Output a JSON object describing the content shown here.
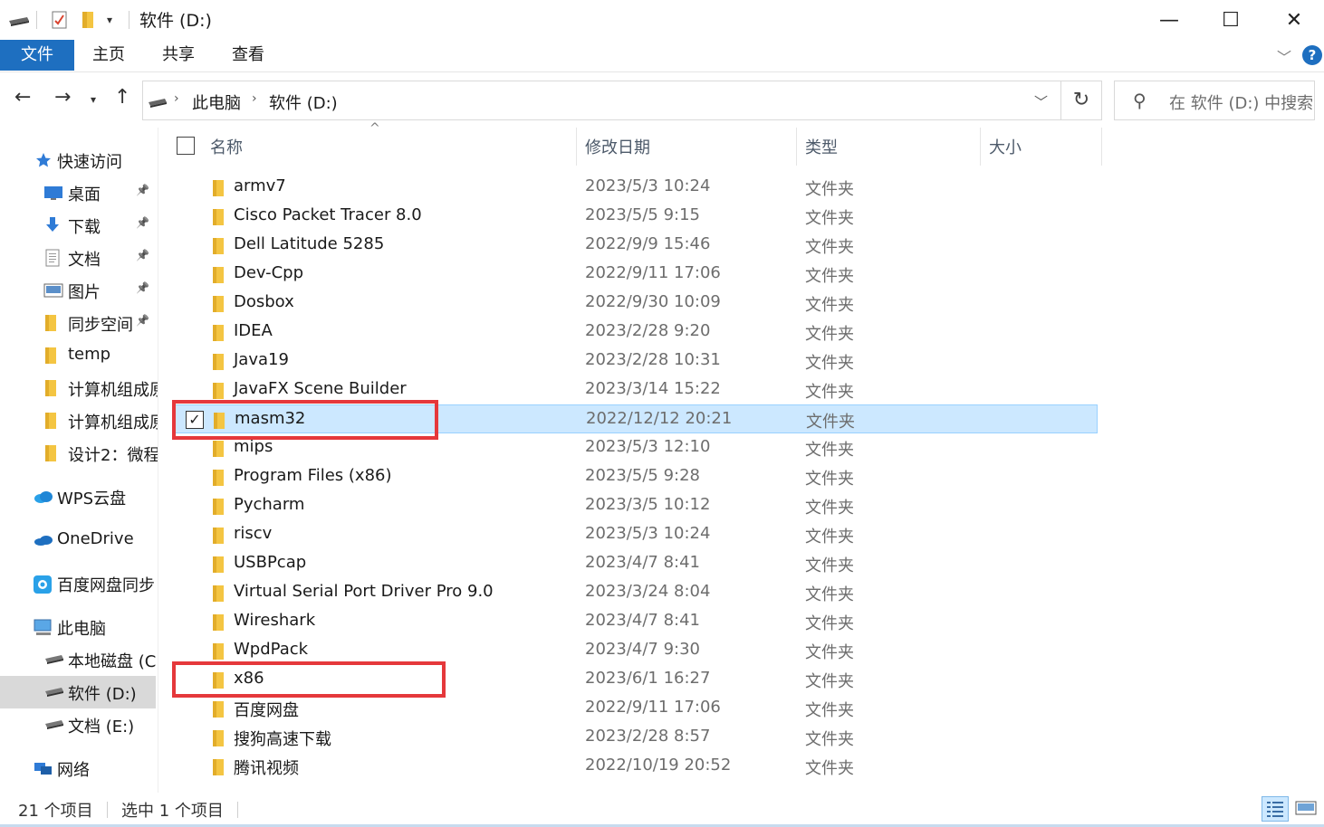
{
  "window": {
    "title": "软件 (D:)",
    "minimize": "—",
    "maximize": "☐",
    "close": "✕"
  },
  "ribbon": {
    "tabs": [
      "文件",
      "主页",
      "共享",
      "查看"
    ],
    "help": "?"
  },
  "nav": {
    "breadcrumb": [
      "此电脑",
      "软件 (D:)"
    ],
    "search_placeholder": "在 软件 (D:) 中搜索"
  },
  "sidebar": {
    "items": [
      {
        "label": "快速访问",
        "icon": "star-icon",
        "pinned": false
      },
      {
        "label": "桌面",
        "icon": "desktop-icon",
        "pinned": true
      },
      {
        "label": "下载",
        "icon": "download-icon",
        "pinned": true
      },
      {
        "label": "文档",
        "icon": "document-icon",
        "pinned": true
      },
      {
        "label": "图片",
        "icon": "pictures-icon",
        "pinned": true
      },
      {
        "label": "同步空间",
        "icon": "folder-icon",
        "pinned": true
      },
      {
        "label": "temp",
        "icon": "folder-icon",
        "pinned": false
      },
      {
        "label": "计算机组成原",
        "icon": "folder-icon",
        "pinned": false
      },
      {
        "label": "计算机组成原",
        "icon": "folder-icon",
        "pinned": false
      },
      {
        "label": "设计2：微程",
        "icon": "folder-icon",
        "pinned": false
      },
      {
        "label": "WPS云盘",
        "icon": "cloud-icon",
        "pinned": false
      },
      {
        "label": "OneDrive",
        "icon": "onedrive-icon",
        "pinned": false
      },
      {
        "label": "百度网盘同步",
        "icon": "baidu-icon",
        "pinned": false
      },
      {
        "label": "此电脑",
        "icon": "computer-icon",
        "pinned": false
      },
      {
        "label": "本地磁盘 (C:",
        "icon": "drive-icon",
        "pinned": false
      },
      {
        "label": "软件 (D:)",
        "icon": "drive-icon",
        "pinned": false
      },
      {
        "label": "文档 (E:)",
        "icon": "drive-icon",
        "pinned": false
      },
      {
        "label": "网络",
        "icon": "network-icon",
        "pinned": false
      }
    ]
  },
  "columns": {
    "name": "名称",
    "date": "修改日期",
    "type": "类型",
    "size": "大小"
  },
  "files": [
    {
      "name": "armv7",
      "date": "2023/5/3 10:24",
      "type": "文件夹"
    },
    {
      "name": "Cisco Packet Tracer 8.0",
      "date": "2023/5/5 9:15",
      "type": "文件夹"
    },
    {
      "name": "Dell Latitude 5285",
      "date": "2022/9/9 15:46",
      "type": "文件夹"
    },
    {
      "name": "Dev-Cpp",
      "date": "2022/9/11 17:06",
      "type": "文件夹"
    },
    {
      "name": "Dosbox",
      "date": "2022/9/30 10:09",
      "type": "文件夹"
    },
    {
      "name": "IDEA",
      "date": "2023/2/28 9:20",
      "type": "文件夹"
    },
    {
      "name": "Java19",
      "date": "2023/2/28 10:31",
      "type": "文件夹"
    },
    {
      "name": "JavaFX Scene Builder",
      "date": "2023/3/14 15:22",
      "type": "文件夹"
    },
    {
      "name": "masm32",
      "date": "2022/12/12 20:21",
      "type": "文件夹"
    },
    {
      "name": "mips",
      "date": "2023/5/3 12:10",
      "type": "文件夹"
    },
    {
      "name": "Program Files (x86)",
      "date": "2023/5/5 9:28",
      "type": "文件夹"
    },
    {
      "name": "Pycharm",
      "date": "2023/3/5 10:12",
      "type": "文件夹"
    },
    {
      "name": "riscv",
      "date": "2023/5/3 10:24",
      "type": "文件夹"
    },
    {
      "name": "USBPcap",
      "date": "2023/4/7 8:41",
      "type": "文件夹"
    },
    {
      "name": "Virtual Serial Port Driver Pro 9.0",
      "date": "2023/3/24 8:04",
      "type": "文件夹"
    },
    {
      "name": "Wireshark",
      "date": "2023/4/7 8:41",
      "type": "文件夹"
    },
    {
      "name": "WpdPack",
      "date": "2023/4/7 9:30",
      "type": "文件夹"
    },
    {
      "name": "x86",
      "date": "2023/6/1 16:27",
      "type": "文件夹"
    },
    {
      "name": "百度网盘",
      "date": "2022/9/11 17:06",
      "type": "文件夹"
    },
    {
      "name": "搜狗高速下载",
      "date": "2023/2/28 8:57",
      "type": "文件夹"
    },
    {
      "name": "腾讯视频",
      "date": "2022/10/19 20:52",
      "type": "文件夹"
    }
  ],
  "selected_row": "masm32",
  "status": {
    "count": "21 个项目",
    "selected": "选中 1 个项目"
  },
  "colors": {
    "accent": "#1e6fc0",
    "selection": "#cce8ff",
    "annotation": "#e5383b",
    "folder": "#f4c542"
  }
}
